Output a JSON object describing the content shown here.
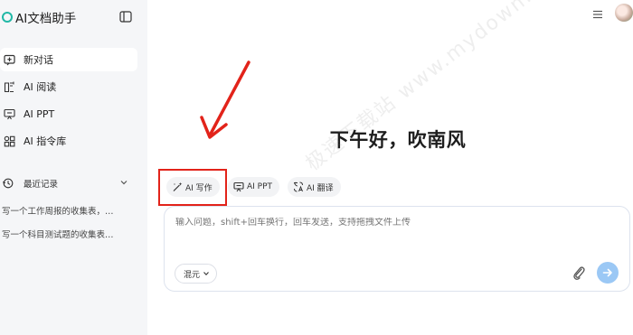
{
  "sidebar": {
    "brand": "AI文档助手",
    "nav": [
      {
        "label": "新对话",
        "icon": "new-chat-icon"
      },
      {
        "label": "AI 阅读",
        "icon": "book-icon"
      },
      {
        "label": "AI PPT",
        "icon": "presentation-icon"
      },
      {
        "label": "AI 指令库",
        "icon": "grid-icon"
      }
    ],
    "recent_title": "最近记录",
    "history": [
      "写一个工作周报的收集表，…",
      "写一个科目测试题的收集表…"
    ]
  },
  "main": {
    "greeting": "下午好，吹南风",
    "chips": [
      {
        "label": "AI 写作",
        "icon": "magic-pen-icon"
      },
      {
        "label": "AI PPT",
        "icon": "presentation-icon"
      },
      {
        "label": "AI 翻译",
        "icon": "translate-icon"
      }
    ],
    "composer": {
      "placeholder": "输入问题，shift+回车换行，回车发送，支持拖拽文件上传",
      "model": "混元"
    }
  },
  "watermark": "极速下载站 www.mydown.com",
  "colors": {
    "accent": "#21b8a6",
    "highlight": "#e2231a",
    "send": "#9bc8f5",
    "sidebar_bg": "#f5f6f8"
  }
}
